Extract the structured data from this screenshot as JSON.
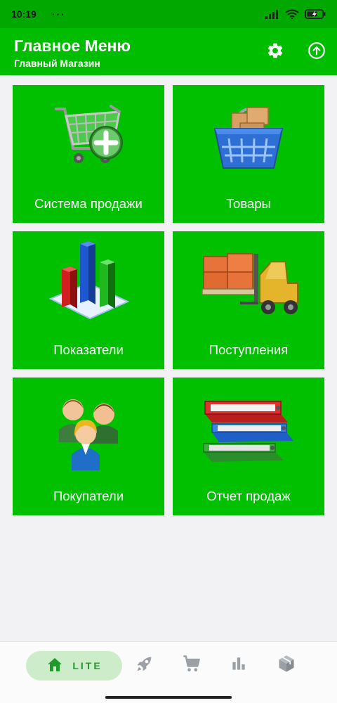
{
  "status_bar": {
    "time": "10:19",
    "dots": "···",
    "icons": [
      "signal-icon",
      "wifi-icon",
      "battery-charging-icon"
    ]
  },
  "app_bar": {
    "title": "Главное Меню",
    "subtitle": "Главный Магазин",
    "actions": [
      "settings-icon",
      "upload-icon"
    ]
  },
  "menu": {
    "tiles": [
      {
        "label": "Система продажи",
        "icon": "shopping-cart-add-icon"
      },
      {
        "label": "Товары",
        "icon": "basket-boxes-icon"
      },
      {
        "label": "Показатели",
        "icon": "bar-chart-3d-icon"
      },
      {
        "label": "Поступления",
        "icon": "forklift-icon"
      },
      {
        "label": "Покупатели",
        "icon": "customers-group-icon"
      },
      {
        "label": "Отчет продаж",
        "icon": "binders-stack-icon"
      }
    ]
  },
  "bottom_nav": {
    "active": {
      "label": "LITE",
      "icon": "home-icon"
    },
    "items": [
      "rocket-icon",
      "cart-icon",
      "bar-chart-icon",
      "box-icon"
    ]
  },
  "colors": {
    "status_bar": "#00a800",
    "app_bar": "#00bd00",
    "tile": "#00c000",
    "nav_active_bg": "#cdecc9",
    "nav_active_fg": "#1f9a2b",
    "nav_icon": "#9aa0a6",
    "background": "#f2f2f4"
  }
}
